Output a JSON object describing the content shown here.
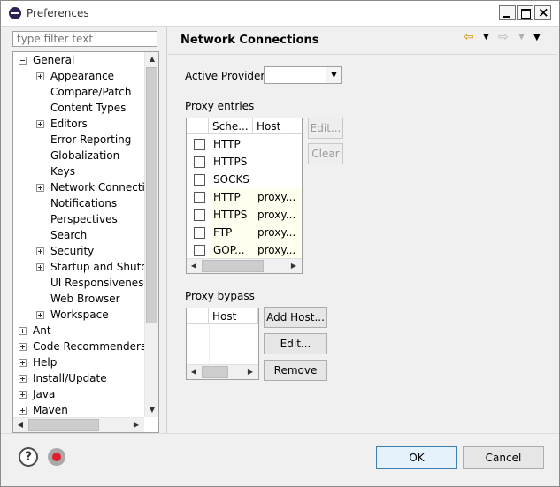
{
  "window": {
    "title": "Preferences"
  },
  "filter": {
    "placeholder": "type filter text"
  },
  "tree": {
    "items": [
      {
        "label": "General",
        "expander": "minus",
        "level": 0
      },
      {
        "label": "Appearance",
        "expander": "plus",
        "level": 1
      },
      {
        "label": "Compare/Patch",
        "expander": "none",
        "level": 1
      },
      {
        "label": "Content Types",
        "expander": "none",
        "level": 1
      },
      {
        "label": "Editors",
        "expander": "plus",
        "level": 1
      },
      {
        "label": "Error Reporting",
        "expander": "none",
        "level": 1
      },
      {
        "label": "Globalization",
        "expander": "none",
        "level": 1
      },
      {
        "label": "Keys",
        "expander": "none",
        "level": 1
      },
      {
        "label": "Network Connection",
        "expander": "plus",
        "level": 1
      },
      {
        "label": "Notifications",
        "expander": "none",
        "level": 1
      },
      {
        "label": "Perspectives",
        "expander": "none",
        "level": 1
      },
      {
        "label": "Search",
        "expander": "none",
        "level": 1
      },
      {
        "label": "Security",
        "expander": "plus",
        "level": 1
      },
      {
        "label": "Startup and Shutdow",
        "expander": "plus",
        "level": 1
      },
      {
        "label": "UI Responsiveness M",
        "expander": "none",
        "level": 1
      },
      {
        "label": "Web Browser",
        "expander": "none",
        "level": 1
      },
      {
        "label": "Workspace",
        "expander": "plus",
        "level": 1
      },
      {
        "label": "Ant",
        "expander": "plus",
        "level": 0
      },
      {
        "label": "Code Recommenders",
        "expander": "plus",
        "level": 0
      },
      {
        "label": "Help",
        "expander": "plus",
        "level": 0
      },
      {
        "label": "Install/Update",
        "expander": "plus",
        "level": 0
      },
      {
        "label": "Java",
        "expander": "plus",
        "level": 0
      },
      {
        "label": "Maven",
        "expander": "plus",
        "level": 0
      }
    ]
  },
  "page": {
    "title": "Network Connections",
    "active_provider_label": "Active Provider:",
    "active_provider_value": "",
    "proxy_entries_label": "Proxy entries",
    "proxy_columns": [
      "Sche...",
      "Host"
    ],
    "proxy_rows": [
      {
        "scheme": "HTTP",
        "host": "",
        "system": false
      },
      {
        "scheme": "HTTPS",
        "host": "",
        "system": false
      },
      {
        "scheme": "SOCKS",
        "host": "",
        "system": false
      },
      {
        "scheme": "HTTP",
        "host": "proxy...",
        "system": true
      },
      {
        "scheme": "HTTPS",
        "host": "proxy...",
        "system": true
      },
      {
        "scheme": "FTP",
        "host": "proxy...",
        "system": true
      },
      {
        "scheme": "GOP...",
        "host": "proxy...",
        "system": true
      }
    ],
    "edit_label": "Edit...",
    "clear_label": "Clear",
    "proxy_bypass_label": "Proxy bypass",
    "bypass_columns": [
      "",
      "Host"
    ],
    "add_host_label": "Add Host...",
    "bypass_edit_label": "Edit...",
    "remove_label": "Remove"
  },
  "buttons": {
    "ok": "OK",
    "cancel": "Cancel"
  }
}
